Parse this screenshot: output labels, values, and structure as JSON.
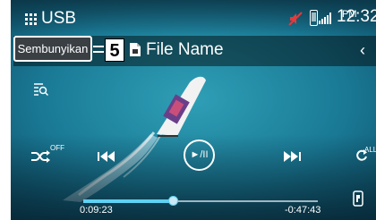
{
  "status_bar": {
    "source_title": "USB",
    "ampm": "PM",
    "clock": "12:32",
    "icons": [
      "grid-menu-icon",
      "mute-icon",
      "phone-icon",
      "signal-icon"
    ]
  },
  "header": {
    "hide_button_label": "Sembunyikan",
    "callout_number": "5",
    "file_name": "File Name",
    "back_icon": "chevron-left-icon"
  },
  "controls": {
    "shuffle_state": "OFF",
    "repeat_state": "ALL",
    "play_pause_label": "►/II",
    "icons": [
      "search-list-icon",
      "shuffle-icon",
      "previous-track-icon",
      "play-pause-icon",
      "next-track-icon",
      "repeat-icon",
      "track-detail-icon"
    ]
  },
  "progress": {
    "elapsed": "0:09:23",
    "remaining": "-0:47:43",
    "fraction": 0.38
  },
  "colors": {
    "accent": "#5fd1f2",
    "sea_dark": "#0b4d66",
    "sea_light": "#2a9fb9",
    "text": "#ffffff",
    "callout_border": "#ffffff"
  }
}
